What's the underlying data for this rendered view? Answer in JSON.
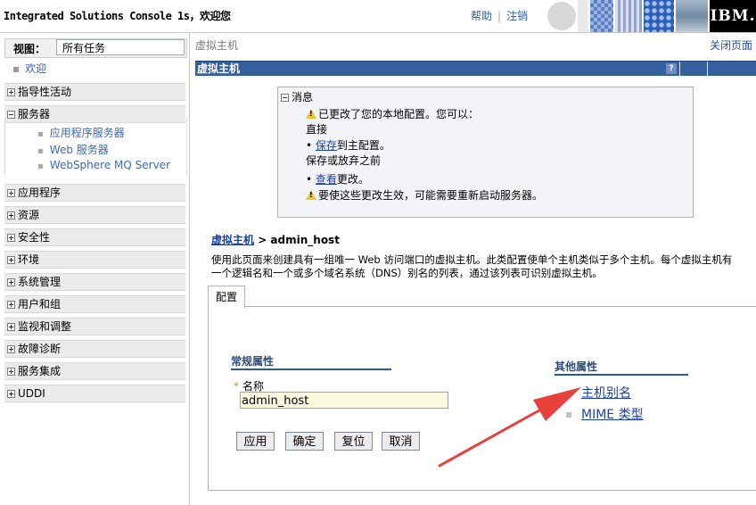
{
  "banner": {
    "title": "Integrated Solutions Console 1s，欢迎您",
    "help_label": "帮助",
    "separator": "|",
    "logout_label": "注销",
    "logo_text": "IBM."
  },
  "nav": {
    "view_label": "视图：",
    "view_value": "所有任务",
    "welcome_label": "欢迎",
    "groups": [
      {
        "label": "指导性活动",
        "expanded": false
      },
      {
        "label": "服务器",
        "expanded": true,
        "children": [
          "应用程序服务器",
          "Web 服务器",
          "WebSphere MQ Server"
        ]
      },
      {
        "label": "应用程序",
        "expanded": false
      },
      {
        "label": "资源",
        "expanded": false
      },
      {
        "label": "安全性",
        "expanded": false
      },
      {
        "label": "环境",
        "expanded": false
      },
      {
        "label": "系统管理",
        "expanded": false
      },
      {
        "label": "用户和组",
        "expanded": false
      },
      {
        "label": "监视和调整",
        "expanded": false
      },
      {
        "label": "故障诊断",
        "expanded": false
      },
      {
        "label": "服务集成",
        "expanded": false
      },
      {
        "label": "UDDI",
        "expanded": false
      }
    ]
  },
  "main": {
    "breadcrumb": "虚拟主机",
    "close_page": "关闭页面",
    "portlet_title": "虚拟主机",
    "help_icon_text": "?",
    "messages": {
      "header": "消息",
      "line1": "已更改了您的本地配置。您可以：",
      "line2": "直接",
      "save_link": "保存",
      "save_rest": "到主配置。",
      "line4": "保存或放弃之前",
      "review_link": "查看",
      "review_rest": "更改。",
      "line6": "要使这些更改生效，可能需要重新启动服务器。"
    },
    "page_path_link": "虚拟主机",
    "page_path_rest": " > admin_host",
    "description_line1": "使用此页面来创建具有一组唯一 Web 访问端口的虚拟主机。此类配置使单个主机类似于多个主机。每个虚拟主机有",
    "description_line2": "一个逻辑名和一个或多个域名系统（DNS）别名的列表，通过该列表可识别虚拟主机。",
    "tab_label": "配置",
    "general_props_title": "常规属性",
    "required_marker": "*",
    "name_label": "名称",
    "name_value": "admin_host",
    "buttons": [
      "应用",
      "确定",
      "复位",
      "取消"
    ],
    "other_props_title": "其他属性",
    "other_links": [
      "主机别名",
      "MIME 类型"
    ]
  },
  "colors": {
    "title_bar": "#365f9e",
    "link": "#1a3fa8",
    "annotation_arrow": "#e8413c",
    "input_background": "#fcf8e0"
  }
}
